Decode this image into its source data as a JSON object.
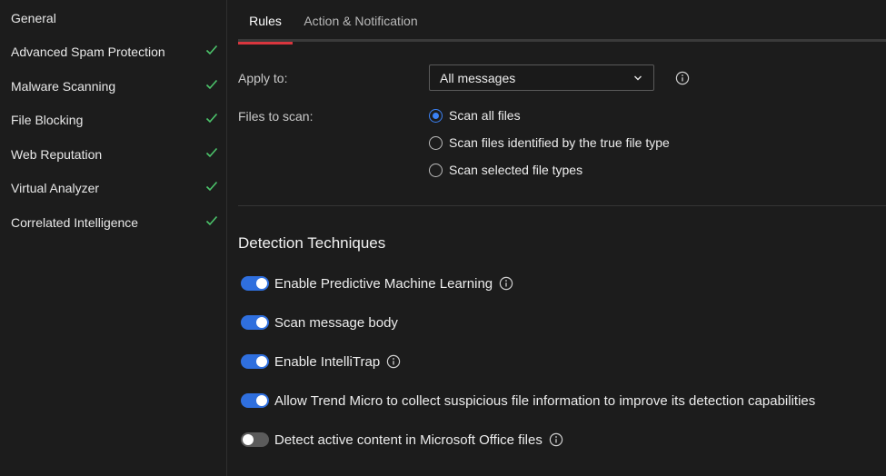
{
  "sidebar": {
    "items": [
      {
        "label": "General",
        "checked": false
      },
      {
        "label": "Advanced Spam Protection",
        "checked": true
      },
      {
        "label": "Malware Scanning",
        "checked": true
      },
      {
        "label": "File Blocking",
        "checked": true
      },
      {
        "label": "Web Reputation",
        "checked": true
      },
      {
        "label": "Virtual Analyzer",
        "checked": true
      },
      {
        "label": "Correlated Intelligence",
        "checked": true
      }
    ]
  },
  "tabs": [
    {
      "label": "Rules",
      "active": true
    },
    {
      "label": "Action & Notification",
      "active": false
    }
  ],
  "rules": {
    "apply_to_label": "Apply to:",
    "apply_to_value": "All messages",
    "files_to_scan_label": "Files to scan:",
    "scan_options": [
      {
        "label": "Scan all files",
        "selected": true
      },
      {
        "label": "Scan files identified by the true file type",
        "selected": false
      },
      {
        "label": "Scan selected file types",
        "selected": false
      }
    ]
  },
  "detection": {
    "title": "Detection Techniques",
    "toggles": [
      {
        "label": "Enable Predictive Machine Learning",
        "on": true,
        "info": true
      },
      {
        "label": "Scan message body",
        "on": true,
        "info": false
      },
      {
        "label": "Enable IntelliTrap",
        "on": true,
        "info": true
      },
      {
        "label": "Allow Trend Micro to collect suspicious file information to improve its detection capabilities",
        "on": true,
        "info": false
      },
      {
        "label": "Detect active content in Microsoft Office files",
        "on": false,
        "info": true
      }
    ]
  },
  "colors": {
    "accent_blue": "#2f6fde",
    "check_green": "#4cc46b",
    "tab_underline": "#d9363e"
  },
  "icons": {
    "check": "check-icon",
    "info": "info-icon",
    "chevron": "chevron-down-icon"
  }
}
